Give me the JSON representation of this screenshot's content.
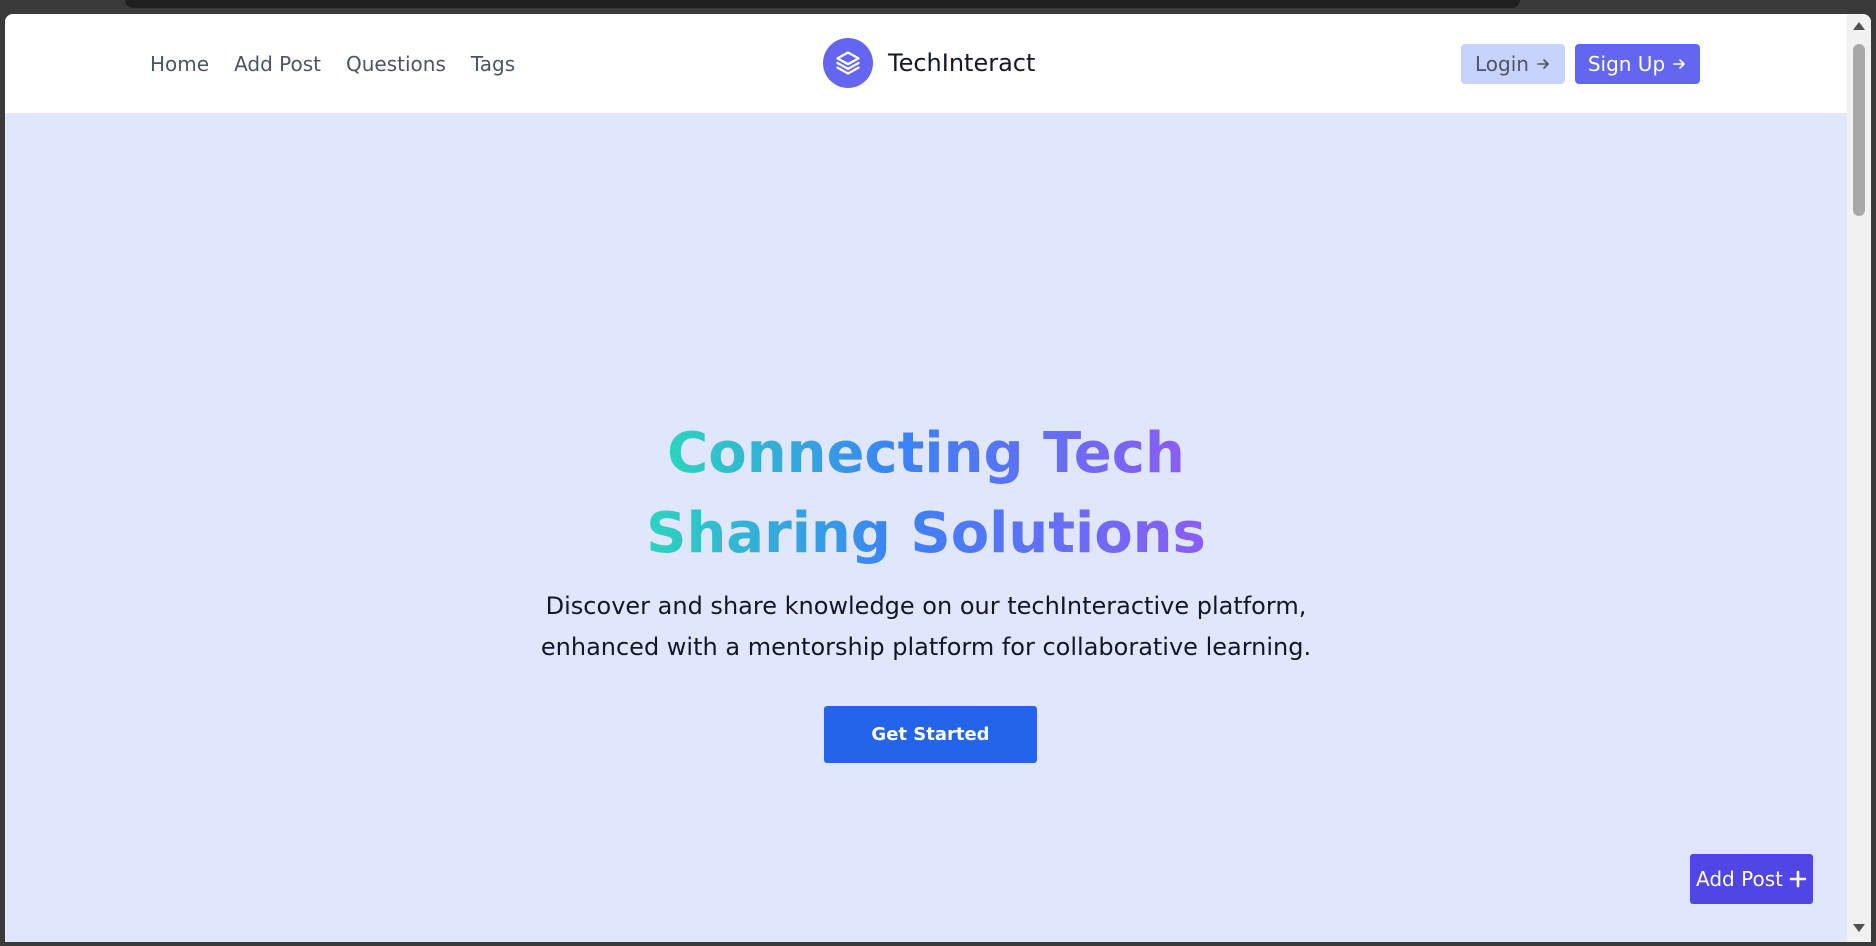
{
  "nav": {
    "links": [
      "Home",
      "Add Post",
      "Questions",
      "Tags"
    ],
    "brand": "TechInteract",
    "login_label": "Login",
    "signup_label": "Sign Up"
  },
  "hero": {
    "title_line1": "Connecting Tech",
    "title_line2": "Sharing Solutions",
    "desc_line1": "Discover and share knowledge on our techInteractive platform,",
    "desc_line2": "enhanced with a mentorship platform for collaborative learning.",
    "cta_label": "Get Started"
  },
  "fab": {
    "label": "Add Post"
  },
  "colors": {
    "accent": "#6366f1",
    "cta": "#2563eb",
    "hero_bg": "#e0e7fd",
    "gradient": [
      "#2dd4bf",
      "#3b82f6",
      "#8b5cf6"
    ]
  }
}
